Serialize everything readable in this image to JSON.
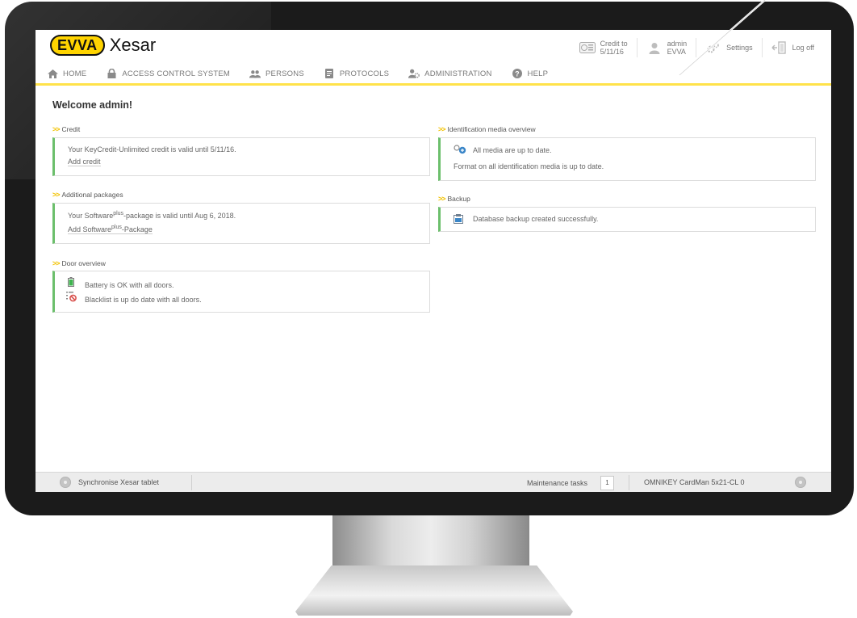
{
  "brand": {
    "badge": "EVVA",
    "product": "Xesar"
  },
  "topbar": {
    "credit_label": "Credit to",
    "credit_date": "5/11/16",
    "user_name": "admin",
    "user_org": "EVVA",
    "settings_label": "Settings",
    "logoff_label": "Log off"
  },
  "nav": [
    {
      "label": "HOME",
      "icon": "home-icon"
    },
    {
      "label": "ACCESS CONTROL SYSTEM",
      "icon": "lock-icon"
    },
    {
      "label": "PERSONS",
      "icon": "persons-icon"
    },
    {
      "label": "PROTOCOLS",
      "icon": "document-icon"
    },
    {
      "label": "ADMINISTRATION",
      "icon": "admin-icon"
    },
    {
      "label": "HELP",
      "icon": "help-icon"
    }
  ],
  "welcome": "Welcome admin!",
  "sections": {
    "credit": {
      "title": "Credit",
      "text": "Your KeyCredit-Unlimited credit is valid until 5/11/16.",
      "link": "Add credit"
    },
    "packages": {
      "title": "Additional packages",
      "text_prefix": "Your Software",
      "text_sup": "plus",
      "text_suffix": "-package is valid until Aug 6, 2018.",
      "link_prefix": "Add Software",
      "link_sup": "plus",
      "link_suffix": "-Package"
    },
    "door": {
      "title": "Door overview",
      "battery": "Battery is OK with all doors.",
      "blacklist": "Blacklist is up do date with all doors."
    },
    "media": {
      "title": "Identification media overview",
      "status": "All media are up to date.",
      "format": "Format on all identification media is up to date."
    },
    "backup": {
      "title": "Backup",
      "status": "Database backup created successfully."
    }
  },
  "statusbar": {
    "sync": "Synchronise Xesar tablet",
    "maint_label": "Maintenance tasks",
    "maint_count": "1",
    "reader": "OMNIKEY CardMan 5x21-CL 0"
  },
  "colors": {
    "accent_yellow": "#ffd400",
    "status_green": "#6cbf6c",
    "bezel": "#1b1b1b"
  }
}
